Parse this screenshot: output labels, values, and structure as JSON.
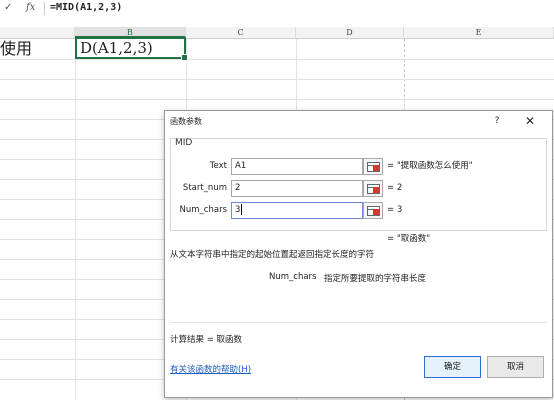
{
  "formula_bar": {
    "check_glyph": "✓",
    "fx_label": "fx",
    "formula": "=MID(A1,2,3)"
  },
  "columns": [
    {
      "label": "B"
    },
    {
      "label": "C"
    },
    {
      "label": "D"
    },
    {
      "label": "E"
    }
  ],
  "cells": {
    "A1": "使用",
    "B1": "D(A1,2,3)"
  },
  "dialog": {
    "title": "函数参数",
    "help_glyph": "?",
    "close_glyph": "✕",
    "function_name": "MID",
    "args": [
      {
        "label": "Text",
        "value": "A1",
        "result": "=  \"提取函数怎么使用\""
      },
      {
        "label": "Start_num",
        "value": "2",
        "result": "=  2"
      },
      {
        "label": "Num_chars",
        "value": "3",
        "result": "=  3"
      }
    ],
    "overall_result": "=  \"取函数\"",
    "description": "从文本字符串中指定的起始位置起返回指定长度的字符",
    "param_name": "Num_chars",
    "param_description": "指定所要提取的字符串长度",
    "calc_result": "计算结果 =   取函数",
    "help_link": "有关该函数的帮助(H)",
    "ok_label": "确定",
    "cancel_label": "取消"
  },
  "colors": {
    "accent": "#217346",
    "link": "#1a5fc2",
    "ok_border": "#2b6fd6"
  },
  "icons": {
    "check": "check-icon",
    "fx": "fx-icon",
    "ref": "range-select-icon"
  }
}
